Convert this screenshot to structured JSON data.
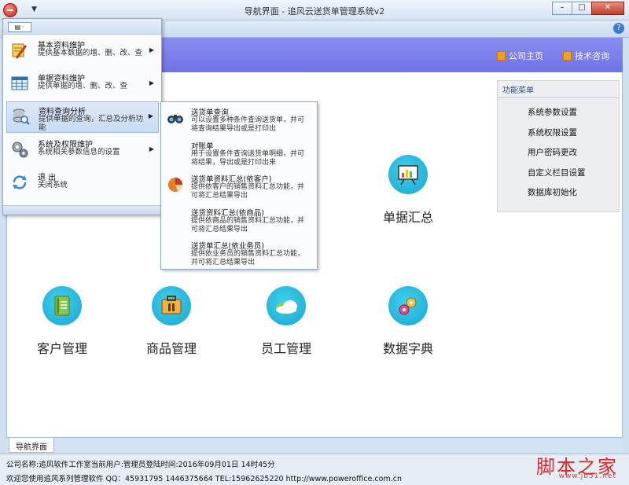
{
  "window": {
    "title": "导航界面 - 追风云送货单管理系统v2",
    "btn_min": "–",
    "btn_max": "□",
    "btn_close": "✕"
  },
  "ribbon": {
    "help": "?"
  },
  "header": {
    "company_home": "公司主页",
    "tech_consult": "技术咨询"
  },
  "app_menu": {
    "head_label": "▤ ·",
    "items": [
      {
        "title": "基本资料维护",
        "desc": "提供基本数据的增、删、改、查",
        "icon": "pencil-document-icon"
      },
      {
        "title": "单据资料维护",
        "desc": "提供单据的增、删、改、查",
        "icon": "table-grid-icon"
      },
      {
        "title": "资料查询分析",
        "desc": "提供单据的查询，汇总及分析功能",
        "icon": "search-database-icon"
      },
      {
        "title": "系统及权限维护",
        "desc": "系统相关参数信息的设置",
        "icon": "gears-icon"
      },
      {
        "title": "退 出",
        "desc": "关闭系统",
        "icon": "refresh-exit-icon"
      }
    ]
  },
  "submenu": {
    "items": [
      {
        "title": "送货单查询",
        "desc": "可以设置多种条件查询送货单，并可将查询结果导出或是打印出"
      },
      {
        "title": "对账单",
        "desc": "用于设置条件查询送货单明细，并可将结果，导出或是打印出来"
      },
      {
        "title": "送货单资料汇总(依客户)",
        "desc": "提供依客户的销售资料汇总功能，并可将汇总结果导出"
      },
      {
        "title": "送货资料汇总(依商品)",
        "desc": "提供依商品的销售资料汇总功能，并可将汇总结果导出"
      },
      {
        "title": "送货单汇总(依业务员)",
        "desc": "提供依业务员的销售资料汇总功能，并可将汇总结果导出"
      }
    ]
  },
  "tiles": {
    "bill_summary": "单据汇总",
    "customer": "客户管理",
    "product": "商品管理",
    "employee": "员工管理",
    "dictionary": "数据字典"
  },
  "func_menu": {
    "title": "功能菜单",
    "items": [
      "系统参数设置",
      "系统权限设置",
      "用户密码更改",
      "自定义栏目设置",
      "数据库初始化"
    ]
  },
  "tabs": {
    "nav": "导航界面"
  },
  "status": {
    "line1": "公司名称:追风软件工作室当前用户:管理员登陆时间:2016年09月01日 14时45分",
    "line2": "欢迎您使用追风系列管理软件 QQ：45931795 1446375664 TEL:15962625220 http://www.poweroffice.com.cn"
  },
  "watermark": {
    "text": "脚本之家",
    "url": "www.jb51.net"
  }
}
